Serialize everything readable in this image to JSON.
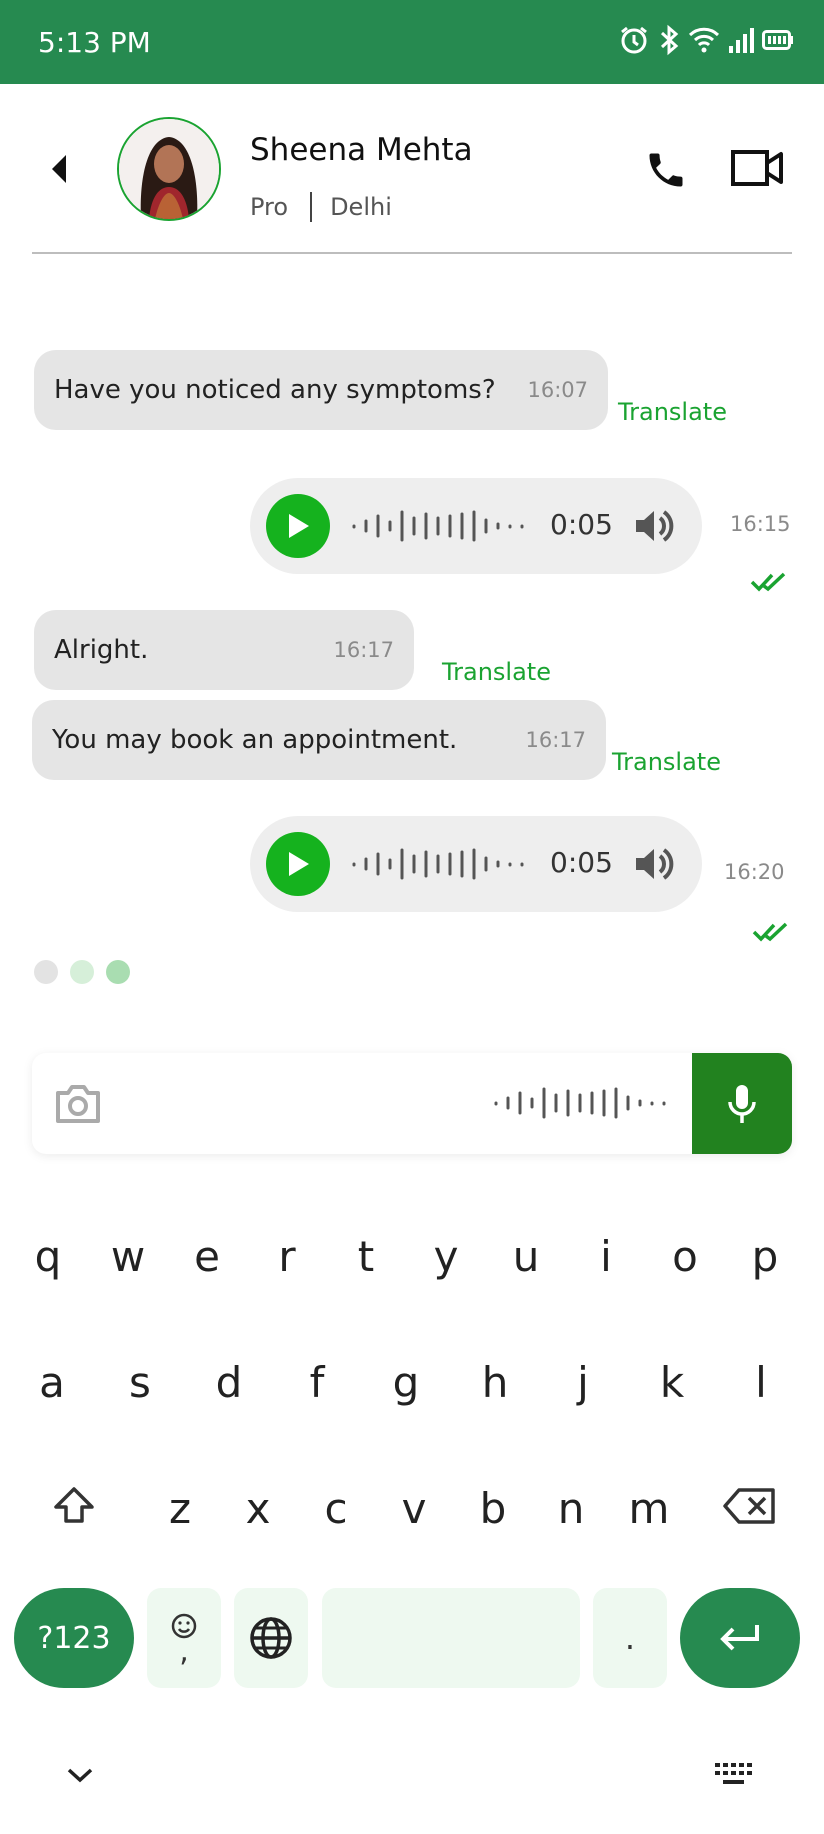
{
  "status_bar": {
    "time": "5:13 PM",
    "icons": [
      "alarm-icon",
      "bluetooth-icon",
      "wifi-icon",
      "signal-icon",
      "battery-icon"
    ]
  },
  "header": {
    "name": "Sheena Mehta",
    "tier": "Pro",
    "city": "Delhi"
  },
  "messages": [
    {
      "type": "text",
      "direction": "in",
      "text": "Have you noticed any symptoms?",
      "time": "16:07",
      "translate": "Translate"
    },
    {
      "type": "voice",
      "direction": "out",
      "duration": "0:05",
      "time": "16:15",
      "read": true
    },
    {
      "type": "text",
      "direction": "in",
      "text": "Alright.",
      "time": "16:17",
      "translate": "Translate"
    },
    {
      "type": "text",
      "direction": "in",
      "text": "You may book an appointment.",
      "time": "16:17",
      "translate": "Translate"
    },
    {
      "type": "voice",
      "direction": "out",
      "duration": "0:05",
      "time": "16:20",
      "read": true
    }
  ],
  "colors": {
    "brand": "#268a50",
    "accent_green": "#15b21e",
    "translate_green": "#1aa331",
    "mic_green": "#22821f"
  },
  "keyboard": {
    "row1": [
      "q",
      "w",
      "e",
      "r",
      "t",
      "y",
      "u",
      "i",
      "o",
      "p"
    ],
    "row2": [
      "a",
      "s",
      "d",
      "f",
      "g",
      "h",
      "j",
      "k",
      "l"
    ],
    "row3": [
      "z",
      "x",
      "c",
      "v",
      "b",
      "n",
      "m"
    ],
    "symbols": "?123",
    "comma": ",",
    "period": "."
  }
}
